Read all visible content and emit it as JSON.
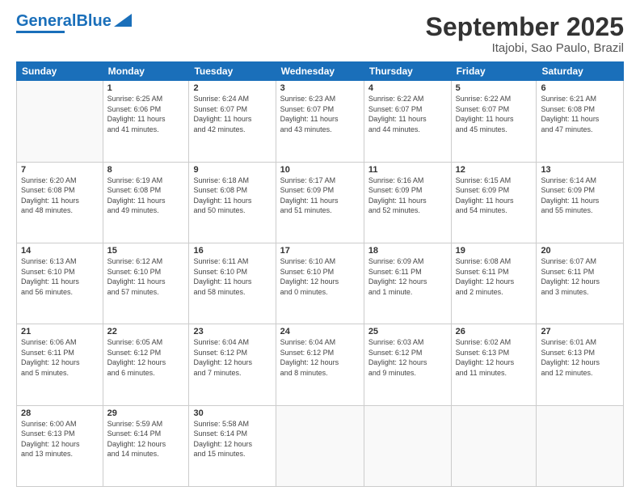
{
  "logo": {
    "text_general": "General",
    "text_blue": "Blue"
  },
  "header": {
    "title": "September 2025",
    "subtitle": "Itajobi, Sao Paulo, Brazil"
  },
  "weekdays": [
    "Sunday",
    "Monday",
    "Tuesday",
    "Wednesday",
    "Thursday",
    "Friday",
    "Saturday"
  ],
  "weeks": [
    [
      {
        "day": "",
        "info": ""
      },
      {
        "day": "1",
        "info": "Sunrise: 6:25 AM\nSunset: 6:06 PM\nDaylight: 11 hours\nand 41 minutes."
      },
      {
        "day": "2",
        "info": "Sunrise: 6:24 AM\nSunset: 6:07 PM\nDaylight: 11 hours\nand 42 minutes."
      },
      {
        "day": "3",
        "info": "Sunrise: 6:23 AM\nSunset: 6:07 PM\nDaylight: 11 hours\nand 43 minutes."
      },
      {
        "day": "4",
        "info": "Sunrise: 6:22 AM\nSunset: 6:07 PM\nDaylight: 11 hours\nand 44 minutes."
      },
      {
        "day": "5",
        "info": "Sunrise: 6:22 AM\nSunset: 6:07 PM\nDaylight: 11 hours\nand 45 minutes."
      },
      {
        "day": "6",
        "info": "Sunrise: 6:21 AM\nSunset: 6:08 PM\nDaylight: 11 hours\nand 47 minutes."
      }
    ],
    [
      {
        "day": "7",
        "info": "Sunrise: 6:20 AM\nSunset: 6:08 PM\nDaylight: 11 hours\nand 48 minutes."
      },
      {
        "day": "8",
        "info": "Sunrise: 6:19 AM\nSunset: 6:08 PM\nDaylight: 11 hours\nand 49 minutes."
      },
      {
        "day": "9",
        "info": "Sunrise: 6:18 AM\nSunset: 6:08 PM\nDaylight: 11 hours\nand 50 minutes."
      },
      {
        "day": "10",
        "info": "Sunrise: 6:17 AM\nSunset: 6:09 PM\nDaylight: 11 hours\nand 51 minutes."
      },
      {
        "day": "11",
        "info": "Sunrise: 6:16 AM\nSunset: 6:09 PM\nDaylight: 11 hours\nand 52 minutes."
      },
      {
        "day": "12",
        "info": "Sunrise: 6:15 AM\nSunset: 6:09 PM\nDaylight: 11 hours\nand 54 minutes."
      },
      {
        "day": "13",
        "info": "Sunrise: 6:14 AM\nSunset: 6:09 PM\nDaylight: 11 hours\nand 55 minutes."
      }
    ],
    [
      {
        "day": "14",
        "info": "Sunrise: 6:13 AM\nSunset: 6:10 PM\nDaylight: 11 hours\nand 56 minutes."
      },
      {
        "day": "15",
        "info": "Sunrise: 6:12 AM\nSunset: 6:10 PM\nDaylight: 11 hours\nand 57 minutes."
      },
      {
        "day": "16",
        "info": "Sunrise: 6:11 AM\nSunset: 6:10 PM\nDaylight: 11 hours\nand 58 minutes."
      },
      {
        "day": "17",
        "info": "Sunrise: 6:10 AM\nSunset: 6:10 PM\nDaylight: 12 hours\nand 0 minutes."
      },
      {
        "day": "18",
        "info": "Sunrise: 6:09 AM\nSunset: 6:11 PM\nDaylight: 12 hours\nand 1 minute."
      },
      {
        "day": "19",
        "info": "Sunrise: 6:08 AM\nSunset: 6:11 PM\nDaylight: 12 hours\nand 2 minutes."
      },
      {
        "day": "20",
        "info": "Sunrise: 6:07 AM\nSunset: 6:11 PM\nDaylight: 12 hours\nand 3 minutes."
      }
    ],
    [
      {
        "day": "21",
        "info": "Sunrise: 6:06 AM\nSunset: 6:11 PM\nDaylight: 12 hours\nand 5 minutes."
      },
      {
        "day": "22",
        "info": "Sunrise: 6:05 AM\nSunset: 6:12 PM\nDaylight: 12 hours\nand 6 minutes."
      },
      {
        "day": "23",
        "info": "Sunrise: 6:04 AM\nSunset: 6:12 PM\nDaylight: 12 hours\nand 7 minutes."
      },
      {
        "day": "24",
        "info": "Sunrise: 6:04 AM\nSunset: 6:12 PM\nDaylight: 12 hours\nand 8 minutes."
      },
      {
        "day": "25",
        "info": "Sunrise: 6:03 AM\nSunset: 6:12 PM\nDaylight: 12 hours\nand 9 minutes."
      },
      {
        "day": "26",
        "info": "Sunrise: 6:02 AM\nSunset: 6:13 PM\nDaylight: 12 hours\nand 11 minutes."
      },
      {
        "day": "27",
        "info": "Sunrise: 6:01 AM\nSunset: 6:13 PM\nDaylight: 12 hours\nand 12 minutes."
      }
    ],
    [
      {
        "day": "28",
        "info": "Sunrise: 6:00 AM\nSunset: 6:13 PM\nDaylight: 12 hours\nand 13 minutes."
      },
      {
        "day": "29",
        "info": "Sunrise: 5:59 AM\nSunset: 6:14 PM\nDaylight: 12 hours\nand 14 minutes."
      },
      {
        "day": "30",
        "info": "Sunrise: 5:58 AM\nSunset: 6:14 PM\nDaylight: 12 hours\nand 15 minutes."
      },
      {
        "day": "",
        "info": ""
      },
      {
        "day": "",
        "info": ""
      },
      {
        "day": "",
        "info": ""
      },
      {
        "day": "",
        "info": ""
      }
    ]
  ]
}
